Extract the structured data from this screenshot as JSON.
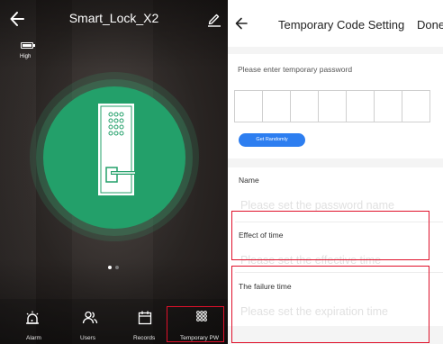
{
  "lock_panel": {
    "title": "Smart_Lock_X2",
    "battery_label": "High",
    "battery_level": 1.0,
    "pager_dots": 2,
    "pager_active": 0,
    "nav": [
      {
        "label": "Alarm",
        "icon": "alarm-icon"
      },
      {
        "label": "Users",
        "icon": "users-icon"
      },
      {
        "label": "Records",
        "icon": "calendar-icon"
      },
      {
        "label": "Temporary PW",
        "icon": "keypad-icon"
      }
    ]
  },
  "settings_panel": {
    "title": "Temporary Code Setting",
    "done_label": "Done",
    "password_prompt": "Please enter temporary password",
    "code_length": 7,
    "get_random_label": "Get Randomly",
    "name": {
      "label": "Name",
      "placeholder": "Please set the password name"
    },
    "effect_time": {
      "label": "Effect of time",
      "placeholder": "Please set the effective time"
    },
    "failure_time": {
      "label": "The failure time",
      "placeholder": "Please set the expiration time"
    }
  },
  "colors": {
    "lock_green": "#23a06a",
    "accent_blue": "#2d7ef0",
    "highlight_red": "#e0102a"
  }
}
